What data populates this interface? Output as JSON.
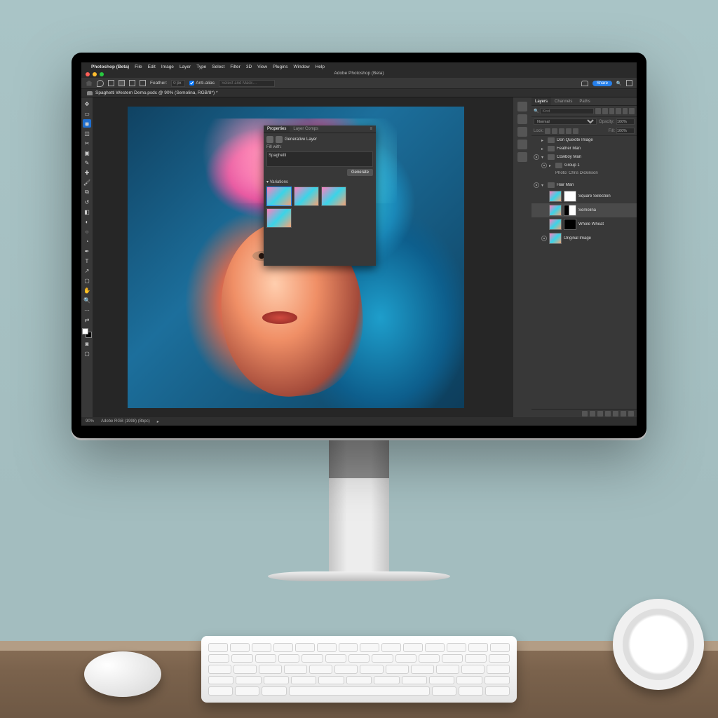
{
  "mac_menu": {
    "app": "Photoshop (Beta)",
    "items": [
      "File",
      "Edit",
      "Image",
      "Layer",
      "Type",
      "Select",
      "Filter",
      "3D",
      "View",
      "Plugins",
      "Window",
      "Help"
    ]
  },
  "window_title": "Adobe Photoshop (Beta)",
  "share_label": "Share",
  "options": {
    "feather_label": "Feather:",
    "feather_value": "0 px",
    "antialias_label": "Anti-alias",
    "task_placeholder": "Select and Mask…"
  },
  "doc_tab": "Spaghetti Western Demo.psdc @ 90% (Semolina, RGB/8*) *",
  "panel_tabs": {
    "layers": "Layers",
    "channels": "Channels",
    "paths": "Paths"
  },
  "layer_filter": {
    "kind_placeholder": "Kind"
  },
  "blend": {
    "mode": "Normal",
    "opacity_label": "Opacity:",
    "opacity": "100%",
    "lock_label": "Lock:",
    "fill_label": "Fill:",
    "fill": "100%"
  },
  "layers": {
    "g1": "Don Quixote Image",
    "g2": "Feather Man",
    "g3": "Cowboy Man",
    "g3a": "Group 1",
    "g3a_credit": "Photo: Chris Dickinson",
    "g4": "Hair Man",
    "l1": "Square Selection",
    "l2": "Semolina",
    "l3": "Whole Wheat",
    "l4": "Original Image"
  },
  "props": {
    "tab_properties": "Properties",
    "tab_comps": "Layer Comps",
    "type": "Generative Layer",
    "fill_label": "Fill with:",
    "fill_value": "Spaghetti",
    "generate": "Generate",
    "variations": "Variations"
  },
  "status": {
    "zoom": "90%",
    "profile": "Adobe RGB (1998) (8bpc)"
  }
}
